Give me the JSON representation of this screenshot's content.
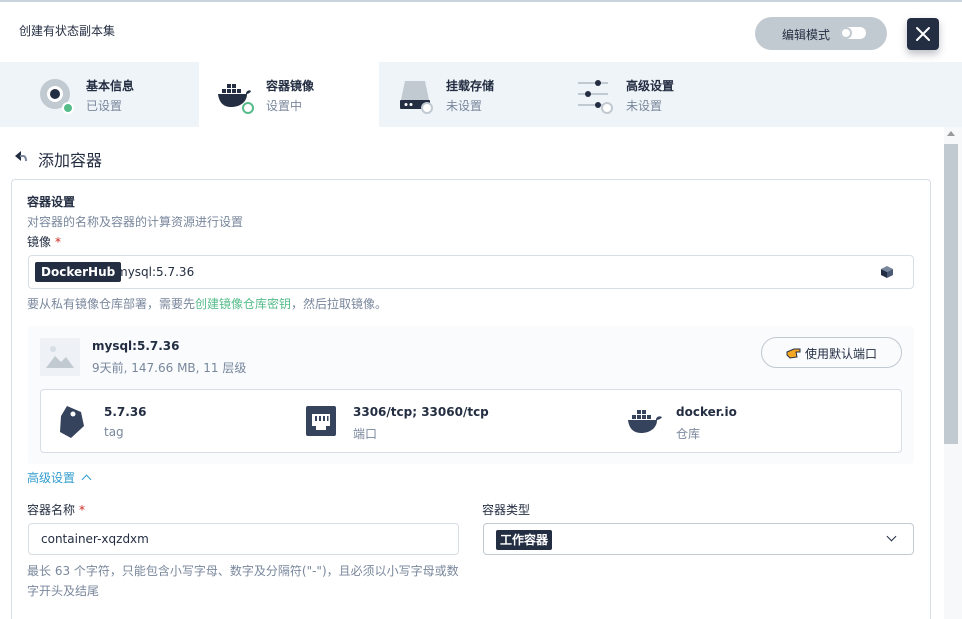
{
  "header": {
    "title": "创建有状态副本集",
    "edit_mode_label": "编辑模式"
  },
  "steps": [
    {
      "title": "基本信息",
      "status": "已设置"
    },
    {
      "title": "容器镜像",
      "status": "设置中"
    },
    {
      "title": "挂载存储",
      "status": "未设置"
    },
    {
      "title": "高级设置",
      "status": "未设置"
    }
  ],
  "section": {
    "title": "添加容器"
  },
  "container_settings": {
    "title": "容器设置",
    "description": "对容器的名称及容器的计算资源进行设置",
    "image_label": "镜像",
    "required_mark": "*",
    "registry_badge": "DockerHub",
    "image_value": "mysql:5.7.36",
    "hint_prefix": "要从私有镜像仓库部署，需要先",
    "hint_link": "创建镜像仓库密钥",
    "hint_suffix": "，然后拉取镜像。"
  },
  "image_info": {
    "name": "mysql:5.7.36",
    "meta": "9天前, 147.66 MB, 11 层级",
    "use_default_ports_label": "使用默认端口",
    "tag_value": "5.7.36",
    "tag_label": "tag",
    "ports_value": "3306/tcp; 33060/tcp",
    "ports_label": "端口",
    "registry_value": "docker.io",
    "registry_label": "仓库"
  },
  "advanced": {
    "toggle_label": "高级设置"
  },
  "container_name": {
    "label": "容器名称",
    "value": "container-xqzdxm",
    "hint": "最长 63 个字符，只能包含小写字母、数字及分隔符(\"-\")，且必须以小写字母或数字开头及结尾"
  },
  "container_type": {
    "label": "容器类型",
    "value": "工作容器"
  },
  "colors": {
    "accent": "#55bc8a",
    "dark": "#242e42",
    "link": "#329dce"
  }
}
